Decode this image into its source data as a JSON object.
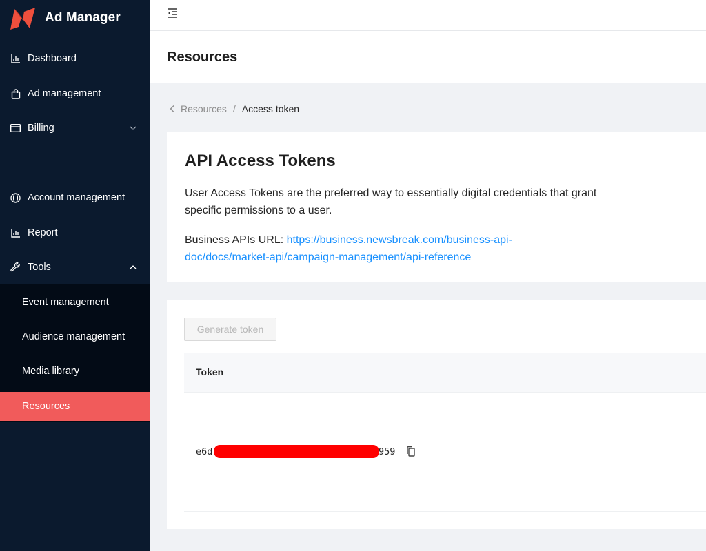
{
  "app": {
    "name": "Ad Manager",
    "accent": "#f15b5b",
    "sidebar_bg": "#0b1a2e"
  },
  "sidebar": {
    "items": [
      {
        "label": "Dashboard",
        "icon": "bar-chart-icon"
      },
      {
        "label": "Ad management",
        "icon": "shopping-bag-icon"
      },
      {
        "label": "Billing",
        "icon": "credit-card-icon"
      },
      {
        "label": "Account management",
        "icon": "globe-icon"
      },
      {
        "label": "Report",
        "icon": "bar-chart-icon"
      },
      {
        "label": "Tools",
        "icon": "wrench-icon"
      }
    ],
    "tools_submenu": [
      {
        "label": "Event management"
      },
      {
        "label": "Audience management"
      },
      {
        "label": "Media library"
      },
      {
        "label": "Resources",
        "active": true
      }
    ]
  },
  "page": {
    "title": "Resources"
  },
  "breadcrumb": {
    "parent": "Resources",
    "separator": "/",
    "current": "Access token"
  },
  "info_card": {
    "title": "API Access Tokens",
    "description": "User Access Tokens are the preferred way to essentially digital credentials that grant specific permissions to a user.",
    "url_label": "Business APIs URL:",
    "url_text": "https://business.newsbreak.com/business-api-doc/docs/market-api/campaign-management/api-reference"
  },
  "token_card": {
    "generate_label": "Generate token",
    "column_token": "Token",
    "token_prefix": "e6d",
    "token_suffix": "959"
  }
}
